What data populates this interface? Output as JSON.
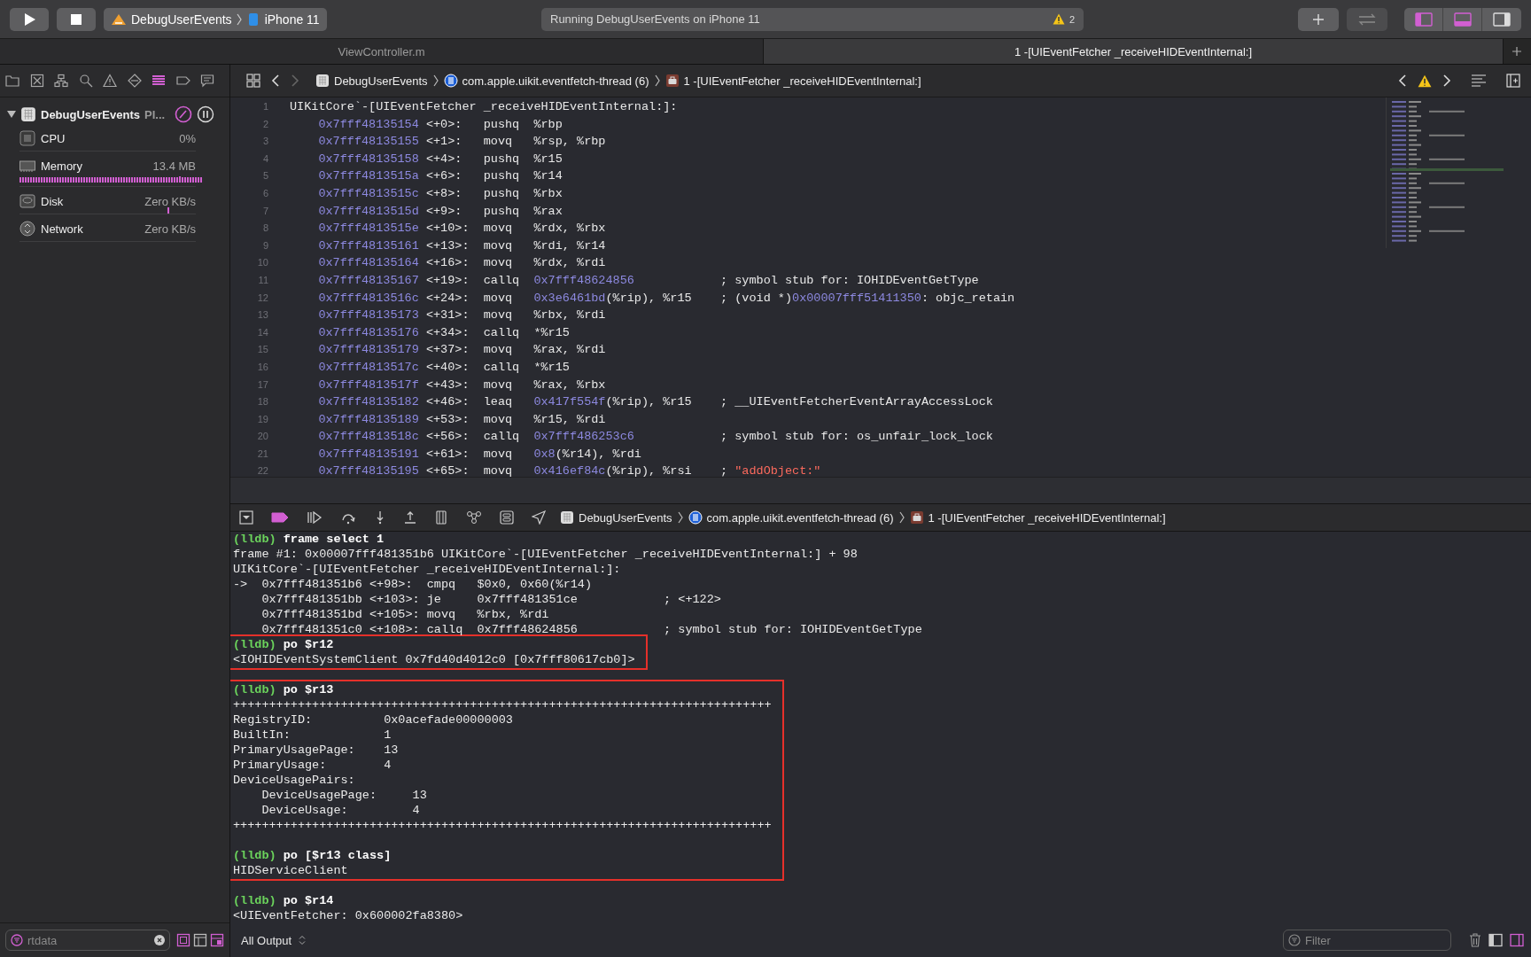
{
  "toolbar": {
    "scheme": "DebugUserEvents",
    "device": "iPhone 11",
    "activity": "Running DebugUserEvents on iPhone 11",
    "warning_count": "2",
    "panel_toggles": [
      {
        "selected": true
      },
      {
        "selected": true
      },
      {
        "selected": false
      }
    ]
  },
  "tabs": [
    {
      "label": "ViewController.m",
      "selected": false
    },
    {
      "label": "1 -[UIEventFetcher _receiveHIDEventInternal:]",
      "selected": true
    }
  ],
  "navigator_tabs": [
    {
      "selected": false
    },
    {
      "selected": false
    },
    {
      "selected": false
    },
    {
      "selected": false
    },
    {
      "selected": false
    },
    {
      "selected": false
    },
    {
      "selected": true
    },
    {
      "selected": false
    },
    {
      "selected": false
    }
  ],
  "jump_bar": [
    {
      "kind": "app",
      "label": "DebugUserEvents"
    },
    {
      "kind": "thread",
      "label": "com.apple.uikit.eventfetch-thread (6)"
    },
    {
      "kind": "frame",
      "label": "1 -[UIEventFetcher _receiveHIDEventInternal:]"
    }
  ],
  "debug_navigator": {
    "process": "DebugUserEvents",
    "process_detail": "PI...",
    "gauges": [
      {
        "kind": "cpu",
        "label": "CPU",
        "value": "0%"
      },
      {
        "kind": "memory",
        "label": "Memory",
        "value": "13.4 MB"
      },
      {
        "kind": "disk",
        "label": "Disk",
        "value": "Zero KB/s"
      },
      {
        "kind": "network",
        "label": "Network",
        "value": "Zero KB/s"
      }
    ]
  },
  "code": {
    "lines": [
      {
        "number": "1",
        "kind": "label",
        "text": "UIKitCore`-[UIEventFetcher _receiveHIDEventInternal:]:"
      },
      {
        "number": "2",
        "kind": "instruction",
        "address": "0x7fff48135154",
        "offset": "<+0>:",
        "mnemonic": "pushq",
        "operands": [
          {
            "kind": "plain",
            "text": "%rbp"
          }
        ]
      },
      {
        "number": "3",
        "kind": "instruction",
        "address": "0x7fff48135155",
        "offset": "<+1>:",
        "mnemonic": "movq",
        "operands": [
          {
            "kind": "plain",
            "text": "%rsp, %rbp"
          }
        ]
      },
      {
        "number": "4",
        "kind": "instruction",
        "address": "0x7fff48135158",
        "offset": "<+4>:",
        "mnemonic": "pushq",
        "operands": [
          {
            "kind": "plain",
            "text": "%r15"
          }
        ]
      },
      {
        "number": "5",
        "kind": "instruction",
        "address": "0x7fff4813515a",
        "offset": "<+6>:",
        "mnemonic": "pushq",
        "operands": [
          {
            "kind": "plain",
            "text": "%r14"
          }
        ]
      },
      {
        "number": "6",
        "kind": "instruction",
        "address": "0x7fff4813515c",
        "offset": "<+8>:",
        "mnemonic": "pushq",
        "operands": [
          {
            "kind": "plain",
            "text": "%rbx"
          }
        ]
      },
      {
        "number": "7",
        "kind": "instruction",
        "address": "0x7fff4813515d",
        "offset": "<+9>:",
        "mnemonic": "pushq",
        "operands": [
          {
            "kind": "plain",
            "text": "%rax"
          }
        ]
      },
      {
        "number": "8",
        "kind": "instruction",
        "address": "0x7fff4813515e",
        "offset": "<+10>:",
        "mnemonic": "movq",
        "operands": [
          {
            "kind": "plain",
            "text": "%rdx, %rbx"
          }
        ]
      },
      {
        "number": "9",
        "kind": "instruction",
        "address": "0x7fff48135161",
        "offset": "<+13>:",
        "mnemonic": "movq",
        "operands": [
          {
            "kind": "plain",
            "text": "%rdi, %r14"
          }
        ]
      },
      {
        "number": "10",
        "kind": "instruction",
        "address": "0x7fff48135164",
        "offset": "<+16>:",
        "mnemonic": "movq",
        "operands": [
          {
            "kind": "plain",
            "text": "%rdx, %rdi"
          }
        ]
      },
      {
        "number": "11",
        "kind": "instruction",
        "address": "0x7fff48135167",
        "offset": "<+19>:",
        "mnemonic": "callq",
        "operands": [
          {
            "kind": "number",
            "text": "0x7fff48624856"
          }
        ],
        "comment": [
          {
            "kind": "plain",
            "text": "; symbol stub for: IOHIDEventGetType"
          }
        ]
      },
      {
        "number": "12",
        "kind": "instruction",
        "address": "0x7fff4813516c",
        "offset": "<+24>:",
        "mnemonic": "movq",
        "operands": [
          {
            "kind": "number",
            "text": "0x3e6461bd"
          },
          {
            "kind": "plain",
            "text": "(%rip), %r15"
          }
        ],
        "comment": [
          {
            "kind": "plain",
            "text": "; (void *)"
          },
          {
            "kind": "number",
            "text": "0x00007fff51411350"
          },
          {
            "kind": "plain",
            "text": ": objc_retain"
          }
        ]
      },
      {
        "number": "13",
        "kind": "instruction",
        "address": "0x7fff48135173",
        "offset": "<+31>:",
        "mnemonic": "movq",
        "operands": [
          {
            "kind": "plain",
            "text": "%rbx, %rdi"
          }
        ]
      },
      {
        "number": "14",
        "kind": "instruction",
        "address": "0x7fff48135176",
        "offset": "<+34>:",
        "mnemonic": "callq",
        "operands": [
          {
            "kind": "plain",
            "text": "*%r15"
          }
        ]
      },
      {
        "number": "15",
        "kind": "instruction",
        "address": "0x7fff48135179",
        "offset": "<+37>:",
        "mnemonic": "movq",
        "operands": [
          {
            "kind": "plain",
            "text": "%rax, %rdi"
          }
        ]
      },
      {
        "number": "16",
        "kind": "instruction",
        "address": "0x7fff4813517c",
        "offset": "<+40>:",
        "mnemonic": "callq",
        "operands": [
          {
            "kind": "plain",
            "text": "*%r15"
          }
        ]
      },
      {
        "number": "17",
        "kind": "instruction",
        "address": "0x7fff4813517f",
        "offset": "<+43>:",
        "mnemonic": "movq",
        "operands": [
          {
            "kind": "plain",
            "text": "%rax, %rbx"
          }
        ]
      },
      {
        "number": "18",
        "kind": "instruction",
        "address": "0x7fff48135182",
        "offset": "<+46>:",
        "mnemonic": "leaq",
        "operands": [
          {
            "kind": "number",
            "text": "0x417f554f"
          },
          {
            "kind": "plain",
            "text": "(%rip), %r15"
          }
        ],
        "comment": [
          {
            "kind": "plain",
            "text": "; __UIEventFetcherEventArrayAccessLock"
          }
        ]
      },
      {
        "number": "19",
        "kind": "instruction",
        "address": "0x7fff48135189",
        "offset": "<+53>:",
        "mnemonic": "movq",
        "operands": [
          {
            "kind": "plain",
            "text": "%r15, %rdi"
          }
        ]
      },
      {
        "number": "20",
        "kind": "instruction",
        "address": "0x7fff4813518c",
        "offset": "<+56>:",
        "mnemonic": "callq",
        "operands": [
          {
            "kind": "number",
            "text": "0x7fff486253c6"
          }
        ],
        "comment": [
          {
            "kind": "plain",
            "text": "; symbol stub for: os_unfair_lock_lock"
          }
        ]
      },
      {
        "number": "21",
        "kind": "instruction",
        "address": "0x7fff48135191",
        "offset": "<+61>:",
        "mnemonic": "movq",
        "operands": [
          {
            "kind": "number",
            "text": "0x8"
          },
          {
            "kind": "plain",
            "text": "(%r14), %rdi"
          }
        ]
      },
      {
        "number": "22",
        "kind": "instruction",
        "address": "0x7fff48135195",
        "offset": "<+65>:",
        "mnemonic": "movq",
        "operands": [
          {
            "kind": "number",
            "text": "0x416ef84c"
          },
          {
            "kind": "plain",
            "text": "(%rip), %rsi"
          }
        ],
        "comment": [
          {
            "kind": "plain",
            "text": "; "
          },
          {
            "kind": "string",
            "text": "\"addObject:\""
          }
        ]
      }
    ]
  },
  "debug_bar": {
    "breakpoints_active": true,
    "breadcrumb": [
      {
        "kind": "app",
        "label": "DebugUserEvents"
      },
      {
        "kind": "thread",
        "label": "com.apple.uikit.eventfetch-thread (6)"
      },
      {
        "kind": "frame",
        "label": "1 -[UIEventFetcher _receiveHIDEventInternal:]"
      }
    ]
  },
  "console": {
    "blocks": [
      {
        "highlighted": false,
        "entries": [
          {
            "prompt": "(lldb)",
            "command": "frame select 1",
            "blank_after": false,
            "output": [
              "frame #1: 0x00007fff481351b6 UIKitCore`-[UIEventFetcher _receiveHIDEventInternal:] + 98",
              "UIKitCore`-[UIEventFetcher _receiveHIDEventInternal:]:",
              "->  0x7fff481351b6 <+98>:  cmpq   $0x0, 0x60(%r14)",
              "    0x7fff481351bb <+103>: je     0x7fff481351ce            ; <+122>",
              "    0x7fff481351bd <+105>: movq   %rbx, %rdi",
              "    0x7fff481351c0 <+108>: callq  0x7fff48624856            ; symbol stub for: IOHIDEventGetType"
            ]
          }
        ]
      },
      {
        "highlighted": true,
        "entries": [
          {
            "prompt": "(lldb)",
            "command": "po $r12",
            "blank_after": true,
            "output": [
              "<IOHIDEventSystemClient 0x7fd40d4012c0 [0x7fff80617cb0]>"
            ]
          }
        ]
      },
      {
        "highlighted": true,
        "entries": [
          {
            "prompt": "(lldb)",
            "command": "po $r13",
            "blank_after": true,
            "output": [
              "+++++++++++++++++++++++++++++++++++++++++++++++++++++++++++++++++++++++++++",
              "RegistryID:          0x0acefade00000003",
              "BuiltIn:             1",
              "PrimaryUsagePage:    13",
              "PrimaryUsage:        4",
              "DeviceUsagePairs:",
              "    DeviceUsagePage:     13",
              "    DeviceUsage:         4",
              "+++++++++++++++++++++++++++++++++++++++++++++++++++++++++++++++++++++++++++"
            ]
          },
          {
            "prompt": "(lldb)",
            "command": "po [$r13 class]",
            "blank_after": true,
            "output": [
              "HIDServiceClient"
            ]
          }
        ]
      },
      {
        "highlighted": false,
        "entries": [
          {
            "prompt": "(lldb)",
            "command": "po $r14",
            "blank_after": false,
            "output": [
              "<UIEventFetcher: 0x600002fa8380>"
            ]
          }
        ]
      }
    ]
  },
  "bottom_bar": {
    "navigator_filter_value": "rtdata",
    "filter_toggles": [
      {
        "on": true
      },
      {
        "on": false
      },
      {
        "on": true
      }
    ],
    "output_menu": "All Output",
    "console_filter_placeholder": "Filter",
    "view_toggles": [
      {
        "selected": false
      },
      {
        "selected": true
      }
    ]
  }
}
